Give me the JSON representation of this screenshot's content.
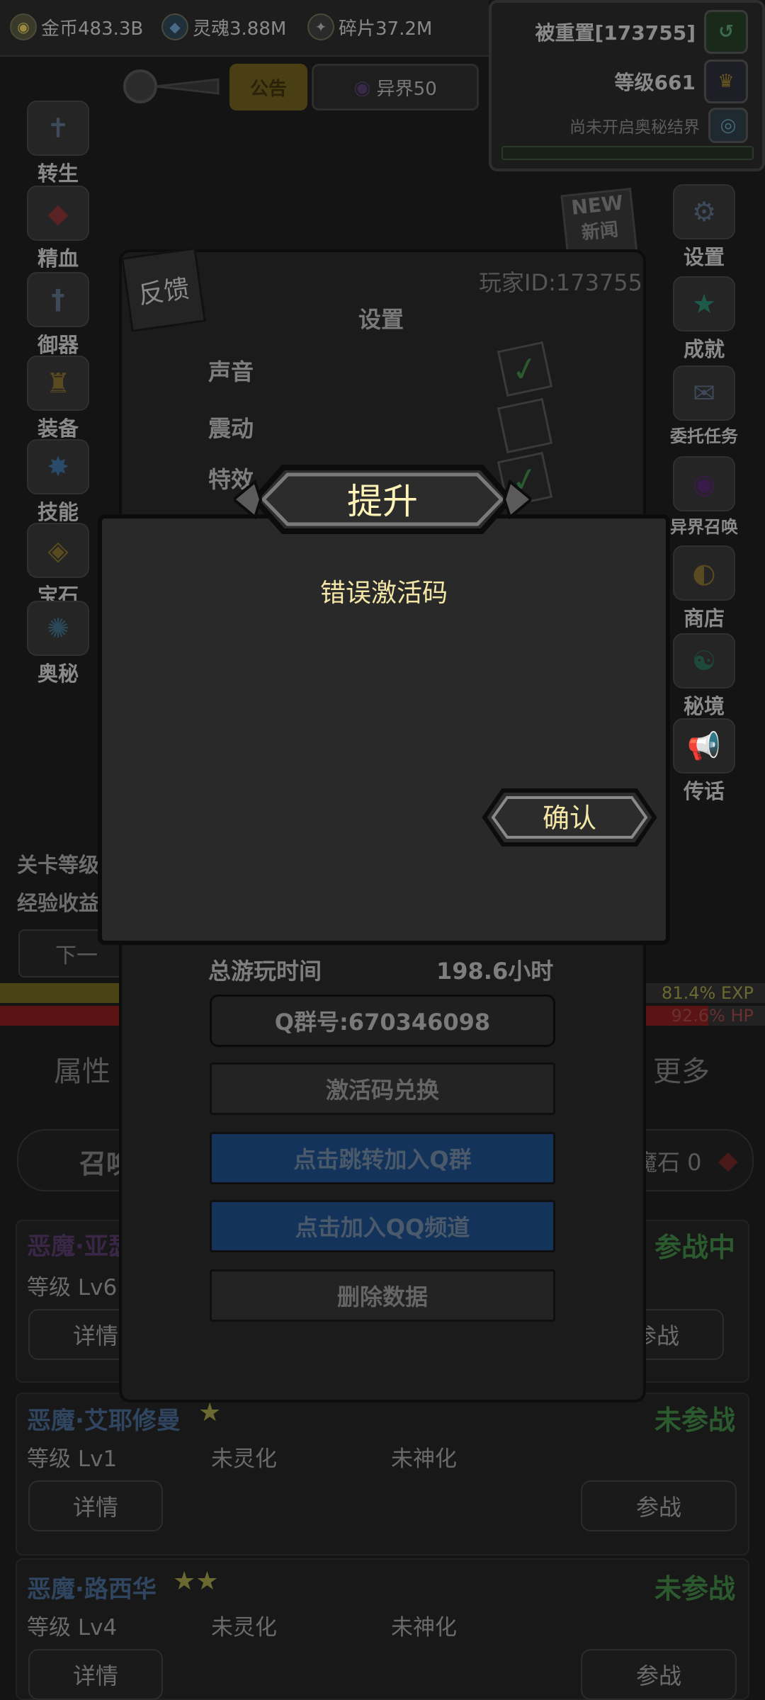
{
  "resources": {
    "gold_label": "金币483.3B",
    "soul_label": "灵魂3.88M",
    "shard_label": "碎片37.2M"
  },
  "player_panel": {
    "reset_label": "被重置[173755]",
    "level_label": "等级661",
    "mystic_label": "尚未开启奥秘结界"
  },
  "top_buttons": {
    "notice": "公告",
    "realm": "异界50"
  },
  "left_menu": [
    "转生",
    "精血",
    "御器",
    "装备",
    "技能",
    "宝石",
    "奥秘"
  ],
  "right_menu": [
    "设置",
    "成就",
    "委托任务",
    "异界召唤",
    "商店",
    "秘境",
    "传话"
  ],
  "news_badge": {
    "line1": "NEW",
    "line2": "新闻"
  },
  "stage_info": {
    "stage_level": "关卡等级",
    "exp_income": "经验收益",
    "next_button": "下一"
  },
  "bars": {
    "exp_text": "81.4% EXP",
    "exp_fraction": 0.814,
    "hp_text": "92.6% HP",
    "hp_fraction": 0.926
  },
  "bottom_tabs": {
    "left": "属性",
    "right": "更多"
  },
  "summon_row": {
    "summon": "召唤",
    "stone_label": "魔石 0"
  },
  "heroes": [
    {
      "name": "恶魔·亚瑟",
      "stars": "",
      "level": "等级 Lv6",
      "spirit": "",
      "divine": "",
      "state": "参战中",
      "details": "详情",
      "join": "参战"
    },
    {
      "name": "恶魔·艾耶修曼",
      "stars": "★",
      "level": "等级 Lv1",
      "spirit": "未灵化",
      "divine": "未神化",
      "state": "未参战",
      "details": "详情",
      "join": "参战"
    },
    {
      "name": "恶魔·路西华",
      "stars": "★★",
      "level": "等级 Lv4",
      "spirit": "未灵化",
      "divine": "未神化",
      "state": "未参战",
      "details": "详情",
      "join": "参战"
    }
  ],
  "settings": {
    "feedback": "反馈",
    "player_id": "玩家ID:173755",
    "title": "设置",
    "sound": "声音",
    "vibration": "震动",
    "effects": "特效",
    "sound_on": true,
    "vibration_on": false,
    "effects_on": true,
    "playtime_label": "总游玩时间",
    "playtime_value": "198.6小时",
    "qq_group": "Q群号:670346098",
    "redeem_code": "激活码兑换",
    "join_qq_group": "点击跳转加入Q群",
    "join_qq_channel": "点击加入QQ频道",
    "delete_data": "删除数据"
  },
  "dialog": {
    "title": "提升",
    "message": "错误激活码",
    "confirm": "确认"
  },
  "colors": {
    "dialog_bg": "#292929",
    "dialog_text": "#f3e6a6",
    "title_text": "#fff3b8",
    "blue_button": "#14335a",
    "hero_name": "#2f4560",
    "state_green": "#2b5a2e"
  }
}
